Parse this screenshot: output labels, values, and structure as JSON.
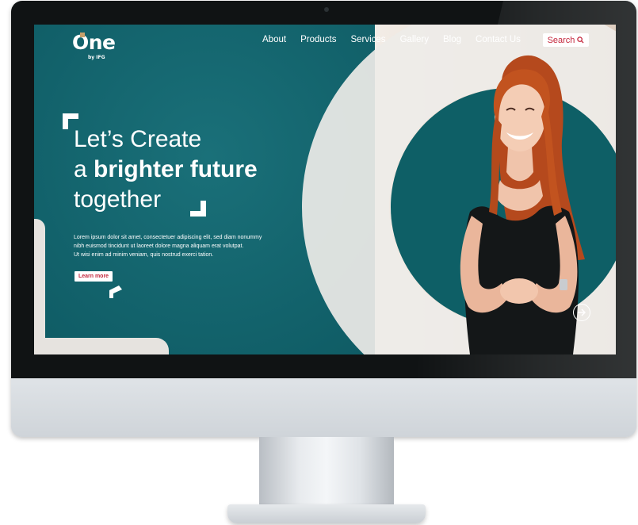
{
  "logo": {
    "mark": "One",
    "sub": "by IFG"
  },
  "nav": {
    "items": [
      {
        "label": "About"
      },
      {
        "label": "Products"
      },
      {
        "label": "Services"
      },
      {
        "label": "Gallery"
      },
      {
        "label": "Blog"
      },
      {
        "label": "Contact Us"
      }
    ],
    "search_label": "Search"
  },
  "hero": {
    "line1": "Let’s Create",
    "line2_prefix": "a ",
    "line2_bold": "brighter future",
    "line3": "together",
    "body": [
      "Lorem ipsum dolor sit amet, consectetuer adipiscing elit, sed diam nonummy",
      "nibh euismod tincidunt ut laoreet dolore magna aliquam erat volutpat.",
      "Ut wisi enim ad minim veniam, quis nostrud exerci tation."
    ],
    "cta_label": "Learn more"
  },
  "carousel": {
    "next_icon": "arrow-right-circle-icon"
  },
  "colors": {
    "teal": "#0f5c65",
    "accent_red": "#c4263c",
    "logo_gold": "#c6a06c"
  }
}
